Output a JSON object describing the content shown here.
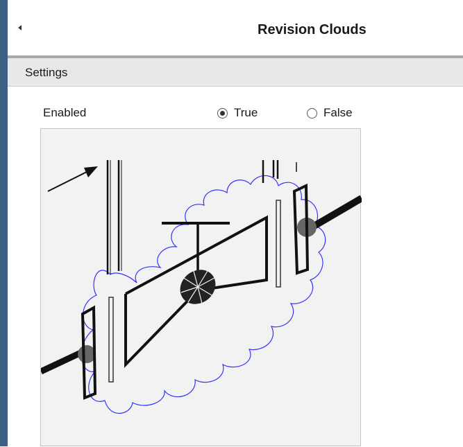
{
  "header": {
    "title": "Revision Clouds"
  },
  "section": {
    "title": "Settings"
  },
  "setting": {
    "label": "Enabled",
    "options": [
      {
        "label": "True",
        "selected": true
      },
      {
        "label": "False",
        "selected": false
      }
    ]
  },
  "colors": {
    "accent_edge": "#3d5f86",
    "cloud": "#3333ff",
    "section_bar": "#e8e8e8"
  }
}
